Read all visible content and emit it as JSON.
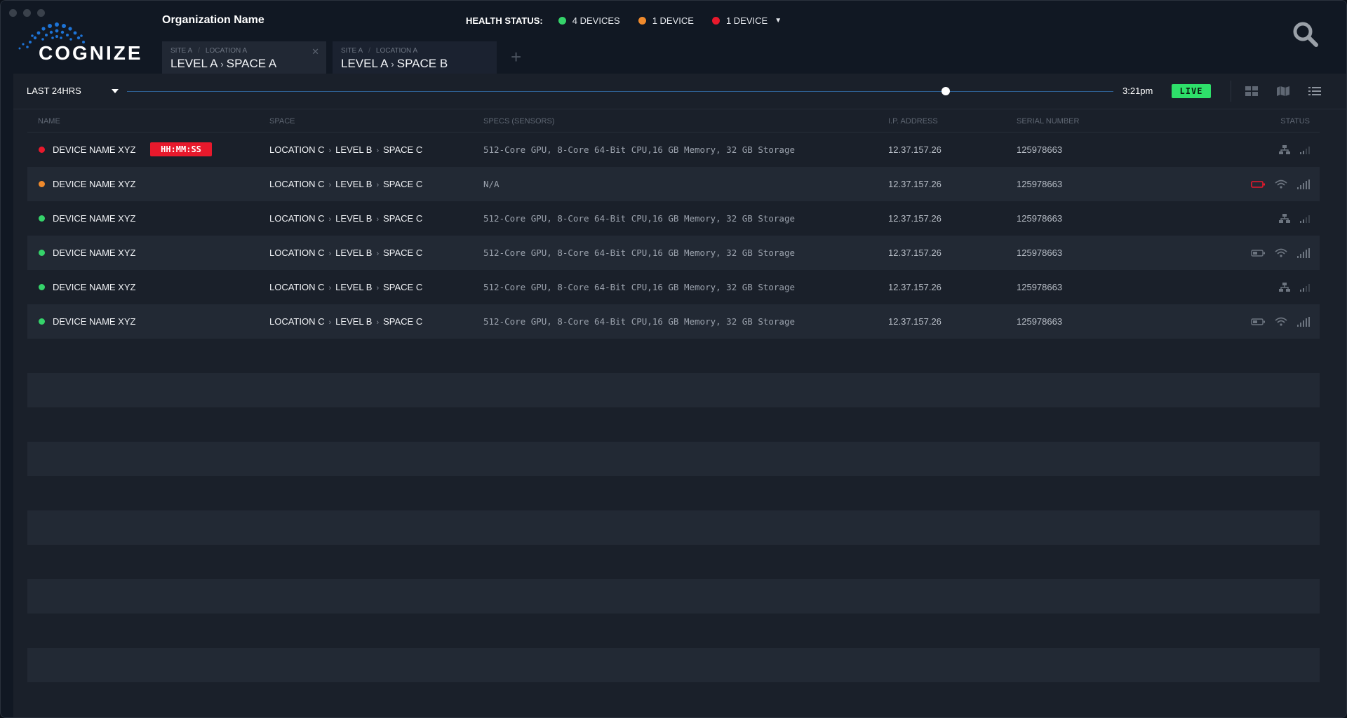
{
  "window": {
    "org_name": "Organization Name",
    "logo_text": "COGNIZE"
  },
  "tabs": [
    {
      "site": "SITE A",
      "location": "LOCATION A",
      "level": "LEVEL A",
      "space": "SPACE A",
      "active": true
    },
    {
      "site": "SITE A",
      "location": "LOCATION A",
      "level": "LEVEL A",
      "space": "SPACE B",
      "active": false
    }
  ],
  "add_tab_label": "+",
  "health": {
    "label": "HEALTH STATUS:",
    "items": [
      {
        "text": "4 DEVICES",
        "color": "#35d36a"
      },
      {
        "text": "1 DEVICE",
        "color": "#f08a2c"
      },
      {
        "text": "1 DEVICE",
        "color": "#e8192c"
      }
    ]
  },
  "timebar": {
    "range": "LAST 24HRS",
    "time": "3:21pm",
    "live": "LIVE",
    "position": 0.83
  },
  "table": {
    "headers": {
      "name": "NAME",
      "space": "SPACE",
      "specs": "SPECS (SENSORS)",
      "ip": "I.P. ADDRESS",
      "serial": "SERIAL NUMBER",
      "status": "STATUS"
    },
    "rows": [
      {
        "name": "DEVICE NAME XYZ",
        "status_color": "#e8192c",
        "alert": "HH:MM:SS",
        "location": "LOCATION C",
        "level": "LEVEL B",
        "space": "SPACE C",
        "specs": "512-Core GPU, 8-Core 64-Bit CPU,16 GB Memory, 32 GB Storage",
        "ip": "12.37.157.26",
        "serial": "125978663"
      },
      {
        "name": "DEVICE NAME XYZ",
        "status_color": "#f08a2c",
        "alert": "",
        "location": "LOCATION C",
        "level": "LEVEL B",
        "space": "SPACE C",
        "specs": "N/A",
        "ip": "12.37.157.26",
        "serial": "125978663"
      },
      {
        "name": "DEVICE NAME XYZ",
        "status_color": "#35d36a",
        "alert": "",
        "location": "LOCATION C",
        "level": "LEVEL B",
        "space": "SPACE C",
        "specs": "512-Core GPU, 8-Core 64-Bit CPU,16 GB Memory, 32 GB Storage",
        "ip": "12.37.157.26",
        "serial": "125978663"
      },
      {
        "name": "DEVICE NAME XYZ",
        "status_color": "#35d36a",
        "alert": "",
        "location": "LOCATION C",
        "level": "LEVEL B",
        "space": "SPACE C",
        "specs": "512-Core GPU, 8-Core 64-Bit CPU,16 GB Memory, 32 GB Storage",
        "ip": "12.37.157.26",
        "serial": "125978663"
      },
      {
        "name": "DEVICE NAME XYZ",
        "status_color": "#35d36a",
        "alert": "",
        "location": "LOCATION C",
        "level": "LEVEL B",
        "space": "SPACE C",
        "specs": "512-Core GPU, 8-Core 64-Bit CPU,16 GB Memory, 32 GB Storage",
        "ip": "12.37.157.26",
        "serial": "125978663"
      },
      {
        "name": "DEVICE NAME XYZ",
        "status_color": "#35d36a",
        "alert": "",
        "location": "LOCATION C",
        "level": "LEVEL B",
        "space": "SPACE C",
        "specs": "512-Core GPU, 8-Core 64-Bit CPU,16 GB Memory, 32 GB Storage",
        "ip": "12.37.157.26",
        "serial": "125978663"
      }
    ],
    "status_icons": [
      [
        "network-icon",
        "signal-low-icon"
      ],
      [
        "battery-low-icon",
        "wifi-icon",
        "signal-full-icon"
      ],
      [
        "network-icon",
        "signal-low-icon"
      ],
      [
        "battery-icon",
        "wifi-icon",
        "signal-full-icon"
      ],
      [
        "network-icon",
        "signal-low-icon"
      ],
      [
        "battery-icon",
        "wifi-icon",
        "signal-full-icon"
      ]
    ]
  },
  "colors": {
    "accent": "#2ee06a",
    "alert": "#e8192c",
    "warning": "#f08a2c",
    "ok": "#35d36a",
    "logo_blue": "#1d73d6"
  }
}
